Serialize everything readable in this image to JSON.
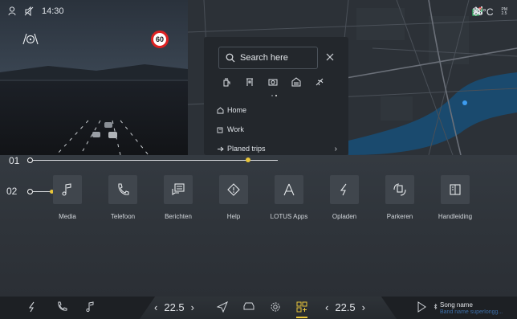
{
  "status": {
    "time": "14:30",
    "temperature": "18°C",
    "pm_label": "PM\n2.5"
  },
  "camera": {
    "speed_limit": "60"
  },
  "search": {
    "placeholder": "Search here",
    "close_icon": "close-icon",
    "categories": [
      "charging-icon",
      "parking-icon",
      "camera-icon",
      "garage-icon",
      "airport-icon"
    ],
    "places": [
      {
        "icon": "home-icon",
        "label": "Home"
      },
      {
        "icon": "work-icon",
        "label": "Work"
      },
      {
        "icon": "trip-icon",
        "label": "Planed trips"
      }
    ]
  },
  "map": {
    "view_mode": "2D"
  },
  "annotations": {
    "label_01": "01",
    "label_02": "02",
    "slider_value": 0.88
  },
  "apps": [
    {
      "label": "Media",
      "icon": "music-note-icon"
    },
    {
      "label": "Telefoon",
      "icon": "phone-icon"
    },
    {
      "label": "Berichten",
      "icon": "message-icon"
    },
    {
      "label": "Help",
      "icon": "help-icon"
    },
    {
      "label": "LOTUS Apps",
      "icon": "apps-icon"
    },
    {
      "label": "Opladen",
      "icon": "charge-icon"
    },
    {
      "label": "Parkeren",
      "icon": "parking-assist-icon"
    },
    {
      "label": "Handleiding",
      "icon": "manual-icon"
    }
  ],
  "bottom_bar": {
    "left_temp": "22.5",
    "right_temp": "22.5",
    "song_title": "Song name",
    "song_artist": "Band name superlongg..."
  },
  "colors": {
    "accent": "#e8c53a",
    "river": "#1a4a6e",
    "artist_text": "#3d6fa8"
  }
}
